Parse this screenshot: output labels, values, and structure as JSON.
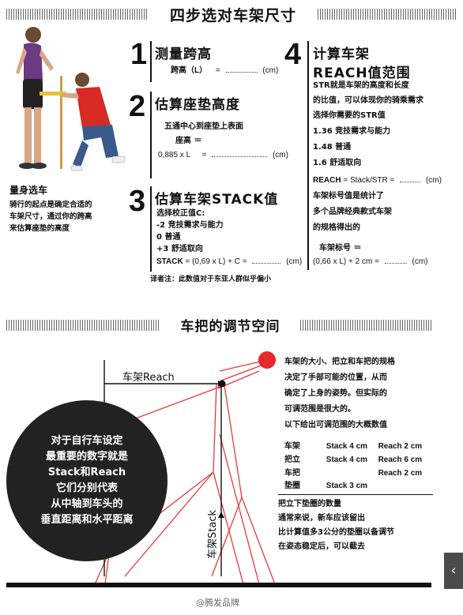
{
  "header": {
    "title": "四步选对车架尺寸"
  },
  "intro": {
    "heading": "量身选车",
    "body": [
      "骑行的起点是确定合适的",
      "车架尺寸，通过你的跨高",
      "来估算座垫的高度"
    ]
  },
  "step1": {
    "num": "1",
    "title": "测量跨高",
    "label": "跨高（L）",
    "eq": "=",
    "unit": "(cm)"
  },
  "step2": {
    "num": "2",
    "title": "估算座垫高度",
    "line1": "五通中心到座垫上表面",
    "line2": "座高 ＝",
    "formula": "0,885 x L",
    "eq": "=",
    "unit": "(cm)"
  },
  "step3": {
    "num": "3",
    "title": "估算车架STACK值",
    "line1": "选择校正值C:",
    "line2": "-2 竞技需求与能力",
    "line3": "0 普通",
    "line4": "+3 舒适取向",
    "formula_label": "STACK",
    "formula": "= (0,69 x L) + C =",
    "unit": "(cm)"
  },
  "step4": {
    "num": "4",
    "title1": "计算车架",
    "title2": "REACH值范围",
    "desc": [
      "STR就是车架的高度和长度",
      "的比值，可以体现你的骑乘需求",
      "选择你需要的STR值"
    ],
    "opts": [
      "1.36 竞技需求与能力",
      "1.48 普通",
      "1.6 舒适取向"
    ],
    "reach_label": "REACH",
    "reach_formula": "= Stack/STR =",
    "unit": "(cm)",
    "frame_desc": [
      "车架标号值是统计了",
      "多个品牌经典款式车架",
      "的规格得出的"
    ],
    "frame_label": "车架标号 ＝",
    "frame_formula": "(0,66 x L) + 2 cm =",
    "unit2": "(cm)"
  },
  "translator_note": "译者注：此数值对于东亚人群似乎偏小",
  "section2": {
    "title": "车把的调节空间",
    "reach_label": "车架Reach",
    "stack_label": "车架Stack",
    "circle_text": [
      "对于自行车设定",
      "最重要的数字就是",
      "Stack和Reach",
      "它们分别代表",
      "从中轴到车头的",
      "垂直距离和水平距离"
    ],
    "desc": [
      "车架的大小、把立和车把的规格",
      "决定了手部可能的位置，从而",
      "确定了上身的姿势。但实际的",
      "可调范围是很大的。",
      "以下给出可调范围的大概数值"
    ],
    "specs": [
      {
        "name": "车架",
        "a": "Stack 4 cm",
        "b": "Reach 2 cm"
      },
      {
        "name": "把立",
        "a": "Stack 4 cm",
        "b": "Reach 6 cm"
      },
      {
        "name": "车把",
        "a": "",
        "b": "Reach 2 cm"
      },
      {
        "name": "垫圈",
        "a": "Stack 3 cm",
        "b": ""
      }
    ],
    "note_title": "把立下垫圈的数量",
    "note": [
      "通常来说，新车应该留出",
      "比计算值多3公分的垫圈以备调节",
      "在姿态稳定后，可以截去"
    ]
  },
  "watermark": "@腾发品牌",
  "side_tab": "‹",
  "colors": {
    "accent_red": "#e8262b",
    "line_red": "#e53a3a",
    "dark": "#222222"
  }
}
